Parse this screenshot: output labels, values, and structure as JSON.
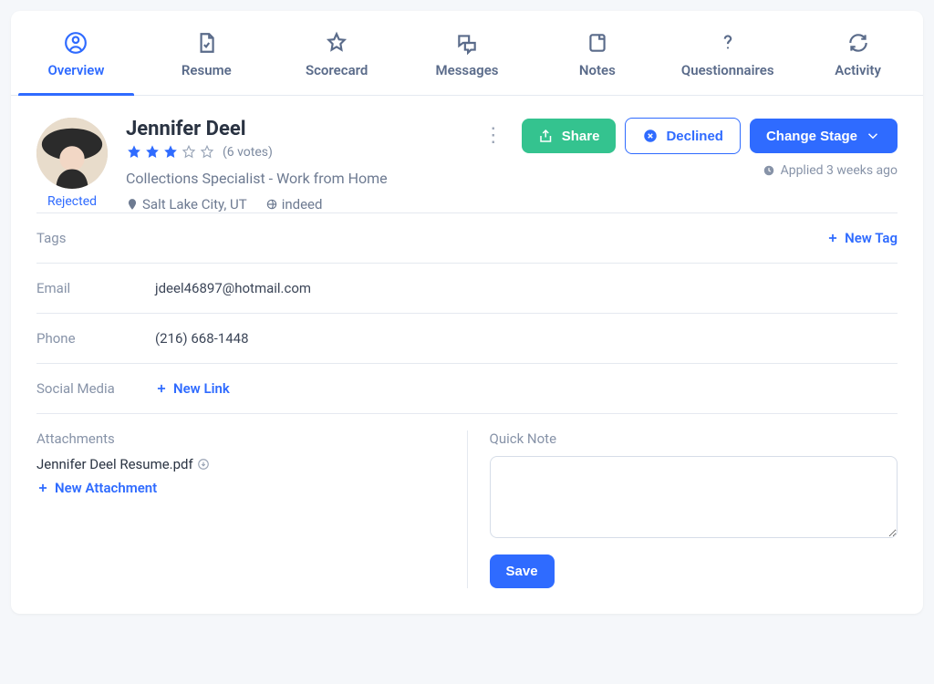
{
  "tabs": {
    "overview": "Overview",
    "resume": "Resume",
    "scorecard": "Scorecard",
    "messages": "Messages",
    "notes": "Notes",
    "questionnaires": "Questionnaires",
    "activity": "Activity"
  },
  "candidate": {
    "name": "Jennifer Deel",
    "status": "Rejected",
    "rating": 3,
    "votes_text": "(6 votes)",
    "job_title": "Collections Specialist - Work from Home",
    "location": "Salt Lake City, UT",
    "source": "indeed",
    "applied_label": "Applied 3 weeks ago"
  },
  "actions": {
    "share": "Share",
    "declined": "Declined",
    "change_stage": "Change Stage"
  },
  "sections": {
    "tags_label": "Tags",
    "new_tag": "New Tag",
    "email_label": "Email",
    "email_value": "jdeel46897@hotmail.com",
    "phone_label": "Phone",
    "phone_value": "(216) 668-1448",
    "social_label": "Social Media",
    "new_link": "New Link",
    "attachments_label": "Attachments",
    "attachment_name": "Jennifer Deel Resume.pdf",
    "new_attachment": "New Attachment",
    "quick_note_label": "Quick Note",
    "save": "Save"
  }
}
